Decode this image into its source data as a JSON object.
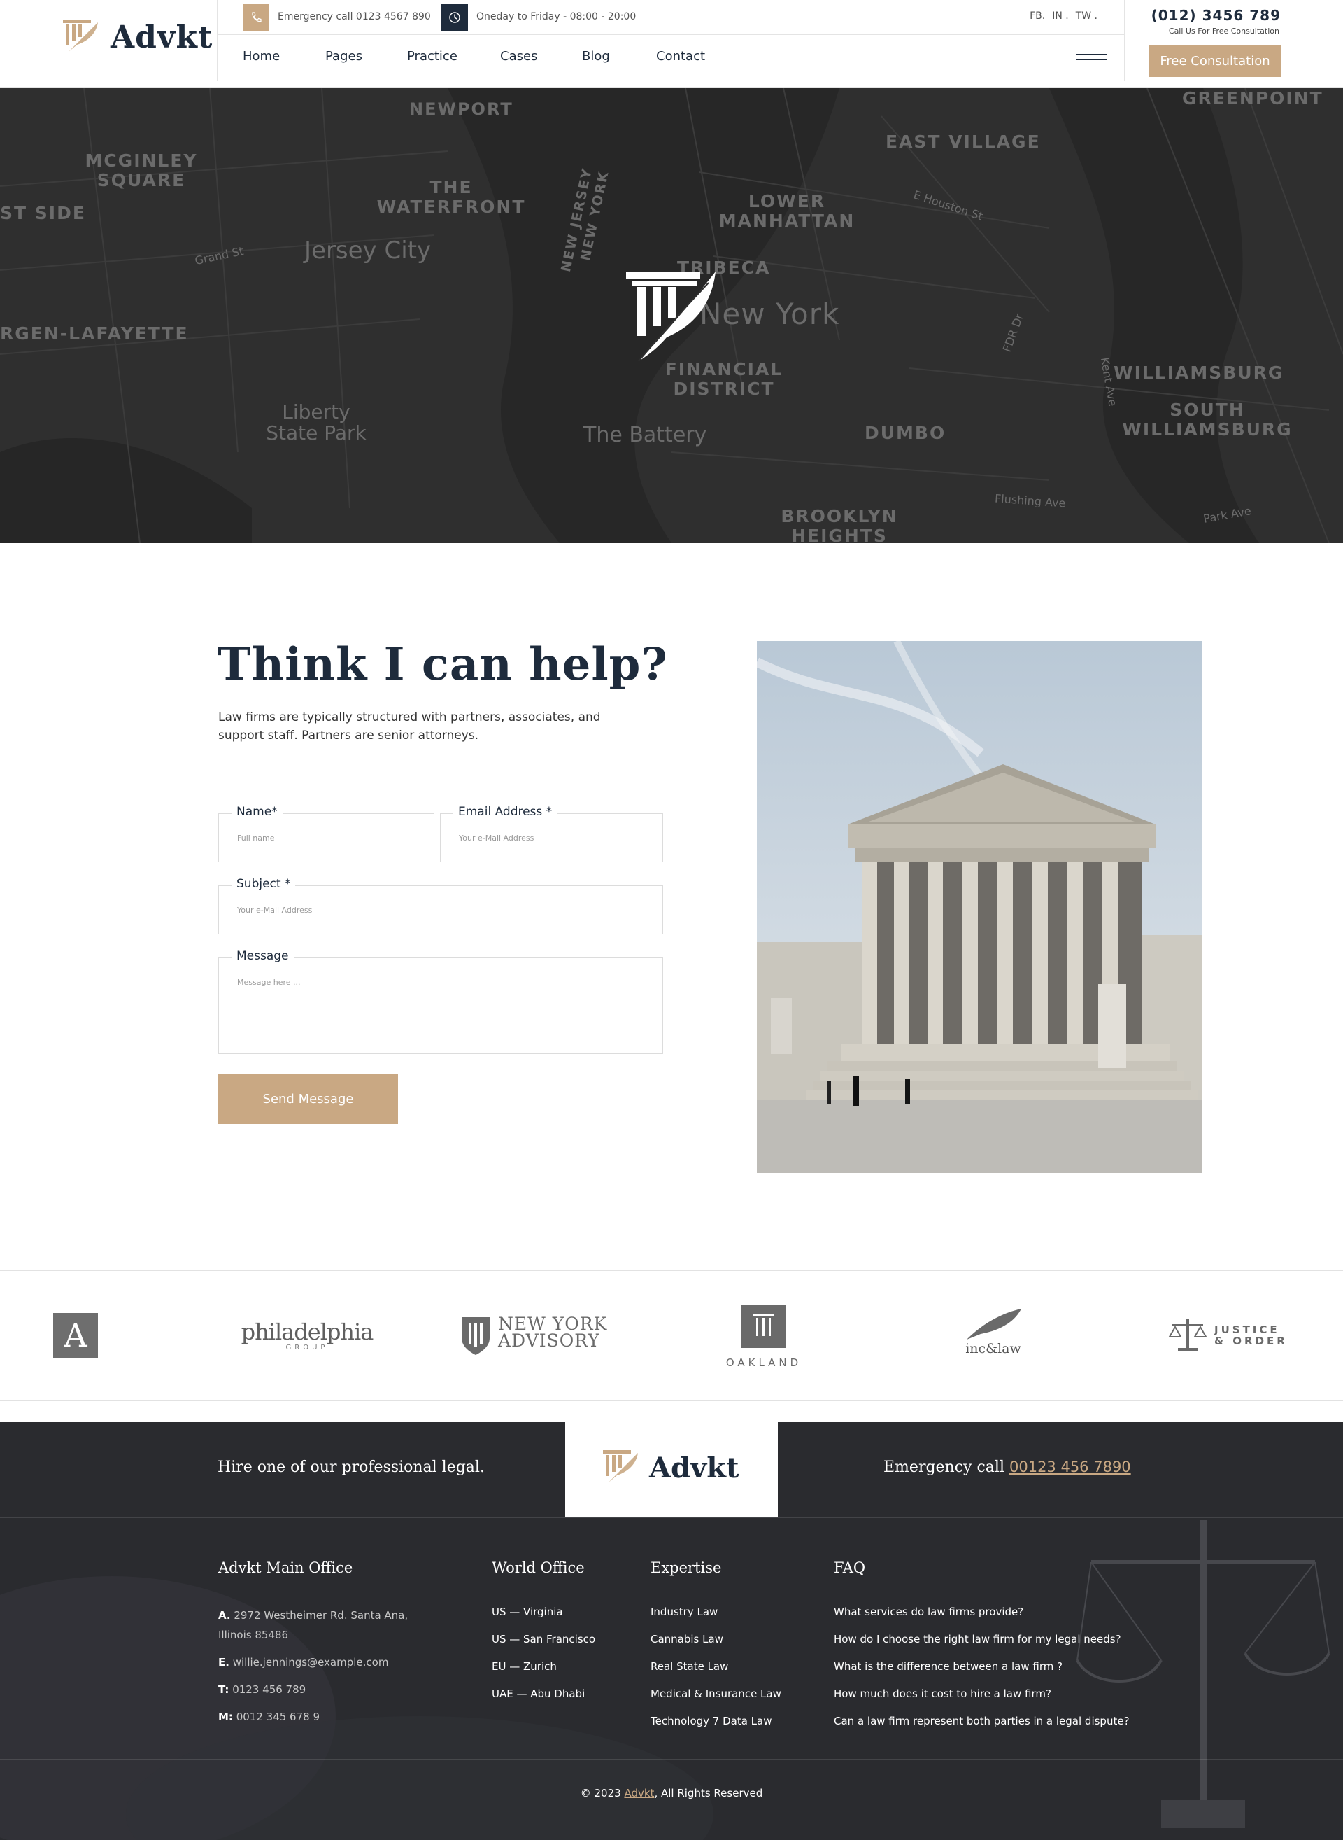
{
  "header": {
    "brand": "Advkt",
    "emergency_text": "Emergency call 0123 4567 890",
    "hours_text": "Oneday to Friday - 08:00 - 20:00",
    "social": [
      "FB.",
      "IN .",
      "TW ."
    ],
    "phone": "(012) 3456 789",
    "phone_sub": "Call Us For Free Consultation",
    "consult_button": "Free Consultation",
    "nav": [
      "Home",
      "Pages",
      "Practice",
      "Cases",
      "Blog",
      "Contact"
    ]
  },
  "hero": {
    "map_labels": [
      "NEWPORT",
      "MCGINLEY SQUARE",
      "THE WATERFRONT",
      "Jersey City",
      "ST SIDE",
      "RGEN-LAFAYETTE",
      "NEW JERSEY",
      "NEW YORK",
      "LOWER MANHATTAN",
      "EAST VILLAGE",
      "TRIBECA",
      "New York",
      "FINANCIAL DISTRICT",
      "Liberty State Park",
      "The Battery",
      "DUMBO",
      "BROOKLYN HEIGHTS",
      "WILLIAMSBURG",
      "SOUTH WILLIAMSBURG",
      "GREENPOINT",
      "Grand St",
      "E Houston St",
      "Flushing Ave",
      "Park Ave",
      "FDR Dr",
      "Kent Ave"
    ]
  },
  "contact": {
    "title": "Think I can help?",
    "description": "Law firms are typically structured with partners, associates, and support staff. Partners are senior attorneys.",
    "fields": {
      "name_label": "Name*",
      "name_placeholder": "Full name",
      "email_label": "Email Address *",
      "email_placeholder": "Your e-Mail Address",
      "subject_label": "Subject *",
      "subject_placeholder": "Your e-Mail Address",
      "message_label": "Message",
      "message_placeholder": "Message here ..."
    },
    "send_button": "Send Message"
  },
  "partners": {
    "logos": [
      "A",
      "philadelphia",
      "GROUP",
      "NEW YORK",
      "ADVISORY",
      "OAKLAND",
      "inc&law",
      "JUSTICE",
      "& ORDER"
    ]
  },
  "footer": {
    "tagline": "Hire one of our professional legal.",
    "brand": "Advkt",
    "emergency_label": "Emergency call",
    "emergency_number": "00123 456 7890",
    "office": {
      "heading": "Advkt Main Office",
      "address_label": "A.",
      "address": "2972 Westheimer Rd. Santa Ana, Illinois 85486",
      "email_label": "E.",
      "email": "willie.jennings@example.com",
      "tel_label": "T:",
      "tel": "0123 456 789",
      "mobile_label": "M:",
      "mobile": "0012 345 678 9"
    },
    "world": {
      "heading": "World Office",
      "items": [
        "US — Virginia",
        "US — San Francisco",
        "EU — Zurich",
        "UAE — Abu Dhabi"
      ]
    },
    "expertise": {
      "heading": "Expertise",
      "items": [
        "Industry Law",
        "Cannabis Law",
        "Real State Law",
        "Medical & Insurance Law",
        "Technology 7 Data Law"
      ]
    },
    "faq": {
      "heading": "FAQ",
      "items": [
        "What services do law firms provide?",
        "How do I choose the right law firm for my legal needs?",
        "What is the difference between a law firm ?",
        "How much does it cost to hire a law firm?",
        "Can a law firm represent both parties in a legal dispute?"
      ]
    },
    "copyright_prefix": "© 2023",
    "copyright_brand": "Advkt",
    "copyright_suffix": ", All Rights Reserved"
  },
  "colors": {
    "accent": "#c9a883",
    "navy": "#1e2b3c",
    "hero_bg": "#2f2f2f",
    "footer_bg": "#282a2e"
  }
}
